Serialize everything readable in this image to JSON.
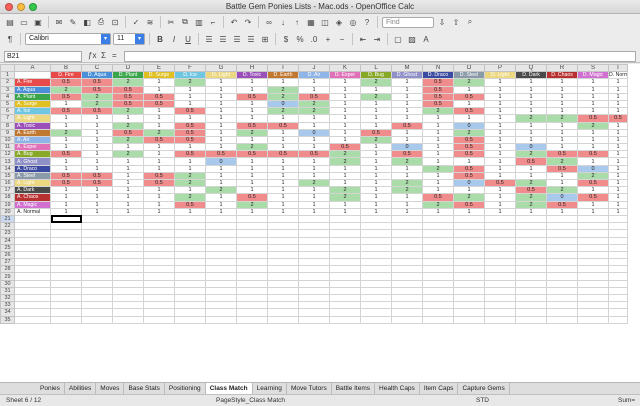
{
  "window": {
    "title": "Battle Gem Ponies Lists - Mac.ods - OpenOffice Calc"
  },
  "toolbar": {
    "find_placeholder": "Find",
    "font_name": "Calibri",
    "font_size": "11"
  },
  "formula_bar": {
    "cell_ref": "B21",
    "formula": ""
  },
  "colors": {
    "Fire": "#e84a4a",
    "Aqua": "#4a90d9",
    "Plant": "#3aa54a",
    "Surge": "#e0c020",
    "Ice": "#6fc6e0",
    "Light": "#ecd880",
    "Toxic": "#9a50b8",
    "Earth": "#c07830",
    "Air": "#8fb4e8",
    "Esper": "#e070b8",
    "Bug": "#88a828",
    "Ghost": "#9090c8",
    "Draco": "#3a4aa0",
    "Steel": "#8a9aa8",
    "Dark": "#4a4a4a",
    "Chaos": "#b83030",
    "Magic": "#d070d0",
    "Normal": "#a89a80",
    "green": "#a9dca9",
    "red": "#f08c8c",
    "blue": "#a8c8ec"
  },
  "columns": [
    "A",
    "B",
    "C",
    "D",
    "E",
    "F",
    "G",
    "H",
    "I",
    "J",
    "K",
    "L",
    "M",
    "N",
    "O",
    "P",
    "Q",
    "R",
    "S",
    "T"
  ],
  "header_row": [
    "",
    "D. Fire",
    "D. Aqua",
    "D. Plant",
    "D. Surge",
    "D. Ice",
    "D. Light",
    "D. Toxic",
    "D. Earth",
    "D. Air",
    "D. Esper",
    "D. Bug",
    "D. Ghost",
    "D. Draco",
    "D. Steel",
    "D. Light",
    "D. Dark",
    "D. Chaos",
    "D. Magic",
    "D. Normal"
  ],
  "row_labels": [
    "A. Fire",
    "A. Aqua",
    "A. Plant",
    "A. Surge",
    "A. Ice",
    "A. Light",
    "A. Toxic",
    "A. Earth",
    "A. Air",
    "A. Esper",
    "A. Bug",
    "A. Ghost",
    "A. Draco",
    "A. Steel",
    "A. Light",
    "A. Dark",
    "A. Chaos",
    "A. Magic",
    "A. Normal"
  ],
  "rows": [
    [
      "0.5",
      "0.5",
      "2",
      "1",
      "2",
      "1",
      "1",
      "1",
      "1",
      "1",
      "2",
      "1",
      "0.5",
      "2",
      "1",
      "1",
      "1",
      "1",
      "1"
    ],
    [
      "2",
      "0.5",
      "0.5",
      "1",
      "1",
      "1",
      "1",
      "2",
      "1",
      "1",
      "1",
      "1",
      "0.5",
      "1",
      "1",
      "1",
      "1",
      "1",
      "1"
    ],
    [
      "0.5",
      "2",
      "0.5",
      "0.5",
      "1",
      "1",
      "0.5",
      "2",
      "0.5",
      "1",
      "2",
      "1",
      "0.5",
      "0.5",
      "1",
      "1",
      "1",
      "1",
      "1"
    ],
    [
      "1",
      "2",
      "0.5",
      "0.5",
      "1",
      "1",
      "1",
      "0",
      "2",
      "1",
      "1",
      "1",
      "0.5",
      "1",
      "1",
      "1",
      "1",
      "1",
      "1"
    ],
    [
      "0.5",
      "0.5",
      "2",
      "1",
      "0.5",
      "1",
      "1",
      "2",
      "2",
      "1",
      "1",
      "1",
      "2",
      "0.5",
      "1",
      "1",
      "1",
      "1",
      "1"
    ],
    [
      "1",
      "1",
      "1",
      "1",
      "1",
      "1",
      "1",
      "1",
      "1",
      "1",
      "1",
      "1",
      "1",
      "1",
      "1",
      "2",
      "2",
      "0.5",
      "0.5"
    ],
    [
      "1",
      "1",
      "2",
      "1",
      "0.5",
      "1",
      "0.5",
      "0.5",
      "1",
      "1",
      "1",
      "0.5",
      "1",
      "0",
      "1",
      "1",
      "1",
      "2",
      "1"
    ],
    [
      "2",
      "1",
      "0.5",
      "2",
      "0.5",
      "1",
      "2",
      "1",
      "0",
      "1",
      "0.5",
      "1",
      "1",
      "2",
      "1",
      "1",
      "1",
      "1",
      "1"
    ],
    [
      "1",
      "1",
      "2",
      "0.5",
      "0.5",
      "1",
      "1",
      "1",
      "1",
      "1",
      "2",
      "1",
      "1",
      "0.5",
      "1",
      "1",
      "1",
      "1",
      "1"
    ],
    [
      "1",
      "1",
      "1",
      "1",
      "1",
      "1",
      "2",
      "1",
      "1",
      "0.5",
      "1",
      "0",
      "1",
      "0.5",
      "1",
      "0",
      "1",
      "1",
      "1"
    ],
    [
      "0.5",
      "1",
      "2",
      "1",
      "0.5",
      "0.5",
      "0.5",
      "0.5",
      "0.5",
      "2",
      "1",
      "0.5",
      "1",
      "0.5",
      "1",
      "2",
      "0.5",
      "0.5",
      "1"
    ],
    [
      "1",
      "1",
      "1",
      "1",
      "1",
      "0",
      "1",
      "1",
      "1",
      "2",
      "1",
      "2",
      "1",
      "1",
      "1",
      "0.5",
      "2",
      "1",
      "1"
    ],
    [
      "1",
      "1",
      "1",
      "1",
      "1",
      "1",
      "1",
      "1",
      "1",
      "1",
      "1",
      "1",
      "2",
      "0.5",
      "1",
      "1",
      "0.5",
      "0",
      "1"
    ],
    [
      "0.5",
      "0.5",
      "1",
      "0.5",
      "2",
      "1",
      "1",
      "1",
      "1",
      "1",
      "1",
      "1",
      "1",
      "0.5",
      "1",
      "1",
      "1",
      "2",
      "1"
    ],
    [
      "0.5",
      "0.5",
      "1",
      "0.5",
      "2",
      "1",
      "1",
      "1",
      "2",
      "1",
      "1",
      "2",
      "1",
      "0",
      "0.5",
      "2",
      "1",
      "0.5",
      "1"
    ],
    [
      "1",
      "1",
      "1",
      "1",
      "1",
      "2",
      "1",
      "1",
      "1",
      "2",
      "1",
      "2",
      "1",
      "1",
      "1",
      "0.5",
      "2",
      "1",
      "1"
    ],
    [
      "1",
      "1",
      "1",
      "1",
      "2",
      "1",
      "0.5",
      "1",
      "1",
      "2",
      "1",
      "1",
      "0.5",
      "2",
      "1",
      "2",
      "0",
      "0.5",
      "1"
    ],
    [
      "1",
      "1",
      "1",
      "1",
      "0.5",
      "1",
      "2",
      "1",
      "1",
      "1",
      "1",
      "1",
      "2",
      "0.5",
      "1",
      "2",
      "0.5",
      "1",
      "1"
    ],
    [
      "1",
      "1",
      "1",
      "1",
      "1",
      "1",
      "1",
      "1",
      "1",
      "1",
      "1",
      "1",
      "1",
      "1",
      "1",
      "1",
      "1",
      "1",
      "1"
    ]
  ],
  "tabs": [
    "Ponies",
    "Abilities",
    "Moves",
    "Base Stats",
    "Positioning",
    "Class Match",
    "Learning",
    "Move Tutors",
    "Battle Items",
    "Health Caps",
    "Item Caps",
    "Capture Gems"
  ],
  "status": {
    "sheet": "Sheet 6 / 12",
    "pagestyle": "PageStyle_Class Match",
    "mode": "STD",
    "sum": "Sum="
  }
}
